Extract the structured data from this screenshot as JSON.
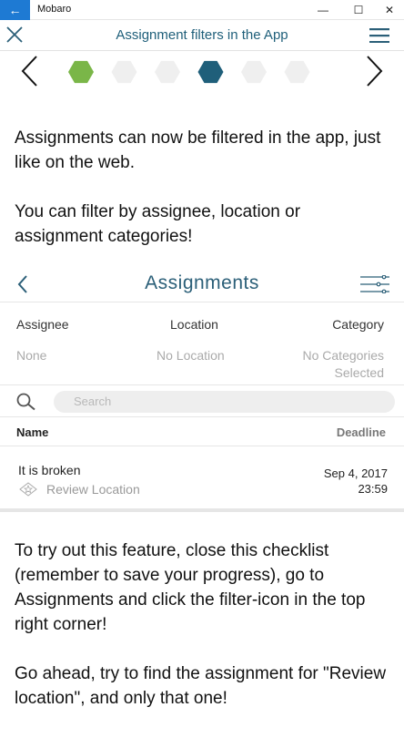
{
  "window": {
    "title": "Mobaro",
    "back_glyph": "←",
    "minimize_glyph": "—",
    "maximize_glyph": "☐",
    "close_glyph": "✕"
  },
  "header": {
    "title": "Assignment filters in the App"
  },
  "stepper": {
    "total_steps": 6,
    "completed_steps": [
      1
    ],
    "current_step": 4,
    "colors": {
      "done": "#7ab648",
      "current": "#1f5f7a",
      "pending": "#efefef"
    }
  },
  "intro": {
    "p1": "Assignments can now be filtered in the app, just like on the web.",
    "p2": "You can filter by assignee, location or assignment categories!"
  },
  "assignments": {
    "title": "Assignments",
    "filters": {
      "assignee_label": "Assignee",
      "assignee_value": "None",
      "location_label": "Location",
      "location_value": "No Location",
      "category_label": "Category",
      "category_value": "No Categories Selected"
    },
    "search_placeholder": "Search",
    "columns": {
      "name": "Name",
      "deadline": "Deadline"
    },
    "rows": [
      {
        "title": "It is broken",
        "location": "Review Location",
        "date": "Sep 4, 2017",
        "time": "23:59"
      }
    ]
  },
  "outro": {
    "p1": "To try out this feature, close this checklist (remember to save your progress), go to Assignments and click the filter-icon in the top right corner!",
    "p2": "Go ahead, try to find the assignment for \"Review location\", and only that one!"
  },
  "colors": {
    "accent": "#1f5f7a",
    "windows_blue": "#1e7ad3"
  }
}
